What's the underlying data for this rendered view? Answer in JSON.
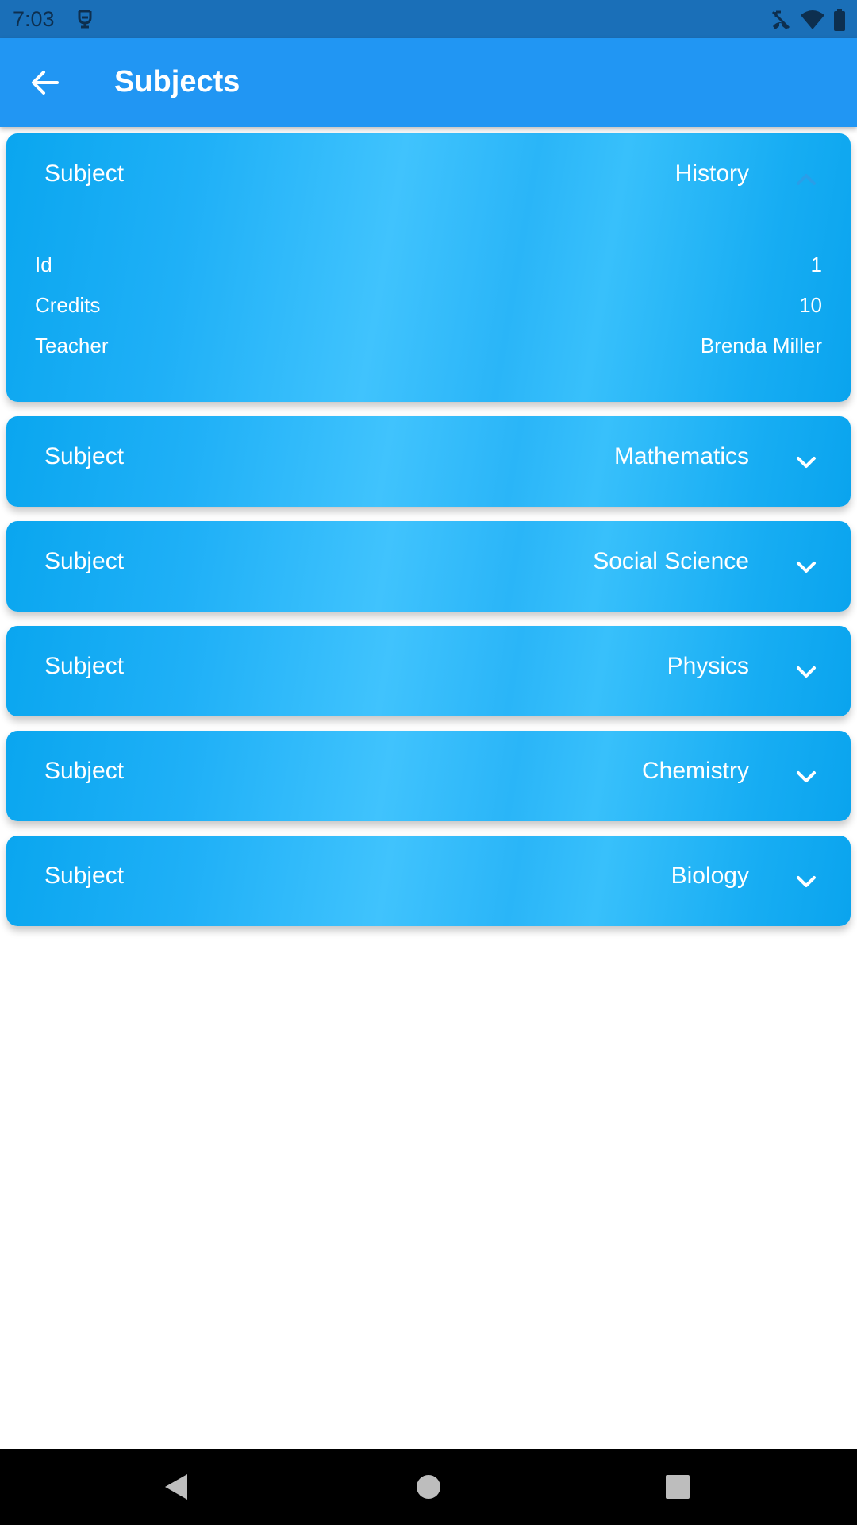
{
  "status_bar": {
    "time": "7:03",
    "icons": [
      "notification-icon",
      "no-calls-icon",
      "wifi-icon",
      "battery-icon"
    ]
  },
  "app_bar": {
    "title": "Subjects",
    "back_icon": "arrow-back-icon",
    "color": "#2196f3"
  },
  "subjects": [
    {
      "label": "Subject",
      "name": "History",
      "expanded": true,
      "details": [
        {
          "key": "Id",
          "value": "1"
        },
        {
          "key": "Credits",
          "value": "10"
        },
        {
          "key": "Teacher",
          "value": "Brenda Miller"
        }
      ]
    },
    {
      "label": "Subject",
      "name": "Mathematics",
      "expanded": false
    },
    {
      "label": "Subject",
      "name": "Social Science",
      "expanded": false
    },
    {
      "label": "Subject",
      "name": "Physics",
      "expanded": false
    },
    {
      "label": "Subject",
      "name": "Chemistry",
      "expanded": false
    },
    {
      "label": "Subject",
      "name": "Biology",
      "expanded": false
    }
  ],
  "nav_bar": {
    "buttons": [
      "back-triangle-icon",
      "home-circle-icon",
      "recents-square-icon"
    ]
  }
}
